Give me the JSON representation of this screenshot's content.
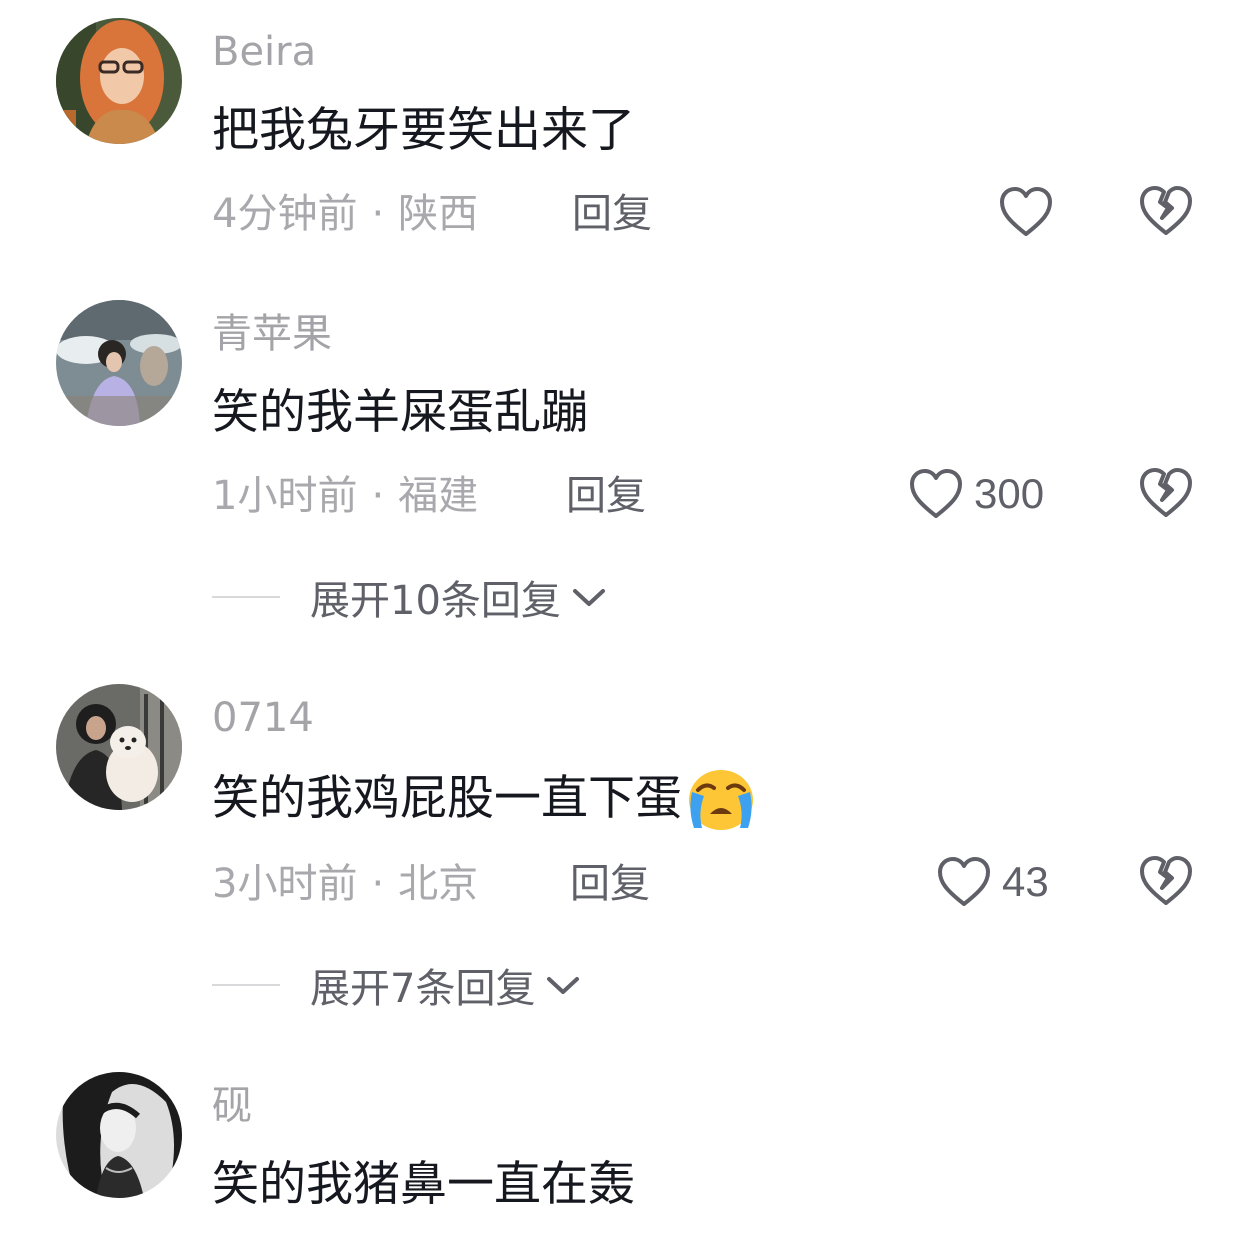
{
  "comments": [
    {
      "username": "Beira",
      "text": "把我兔牙要笑出来了",
      "time": "4分钟前",
      "location": "陕西",
      "reply_label": "回复",
      "likes": null
    },
    {
      "username": "青苹果",
      "text": "笑的我羊屎蛋乱蹦",
      "time": "1小时前",
      "location": "福建",
      "reply_label": "回复",
      "likes": "300",
      "expand_label": "展开10条回复"
    },
    {
      "username": "0714",
      "text": "笑的我鸡屁股一直下蛋",
      "emoji": "loudly-crying-face",
      "time": "3小时前",
      "location": "北京",
      "reply_label": "回复",
      "likes": "43",
      "expand_label": "展开7条回复"
    },
    {
      "username": "砚",
      "text": "笑的我猪鼻一直在轰"
    }
  ],
  "separator": "·",
  "icons": {
    "like": "heart-outline-icon",
    "dislike": "broken-heart-icon",
    "expand": "chevron-down-icon"
  },
  "colors": {
    "text": "#16181f",
    "muted": "#a8a8ad",
    "action": "#5f6068"
  }
}
